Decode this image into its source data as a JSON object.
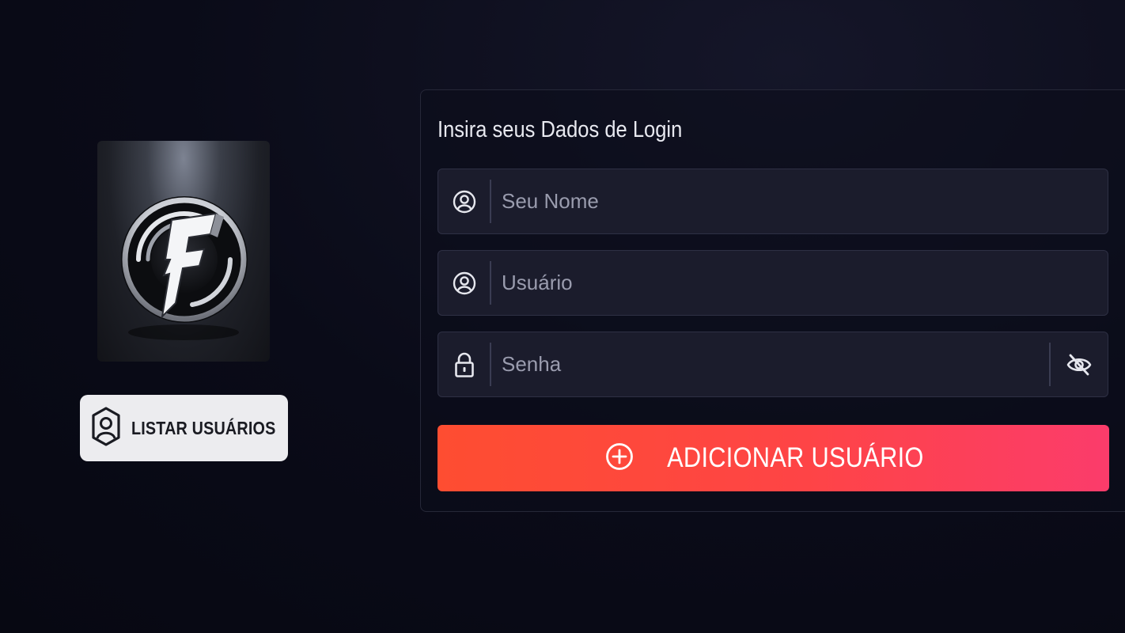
{
  "sidebar": {
    "logo_icon": "shield-f-logo",
    "list_users": {
      "icon": "user-shield-icon",
      "label": "LISTAR USUÁRIOS"
    }
  },
  "form": {
    "title": "Insira seus Dados de Login",
    "name_field": {
      "icon": "user-circle-icon",
      "placeholder": "Seu Nome",
      "value": ""
    },
    "user_field": {
      "icon": "user-circle-icon",
      "placeholder": "Usuário",
      "value": ""
    },
    "password_field": {
      "icon": "lock-icon",
      "placeholder": "Senha",
      "value": "",
      "toggle_icon": "eye-off-icon"
    },
    "submit": {
      "icon": "plus-circle-icon",
      "label": "ADICIONAR USUÁRIO"
    }
  },
  "colors": {
    "background": "#0a0b18",
    "field_bg": "#1b1c2c",
    "accent_start": "#fe4d31",
    "accent_end": "#fb3c6b"
  }
}
